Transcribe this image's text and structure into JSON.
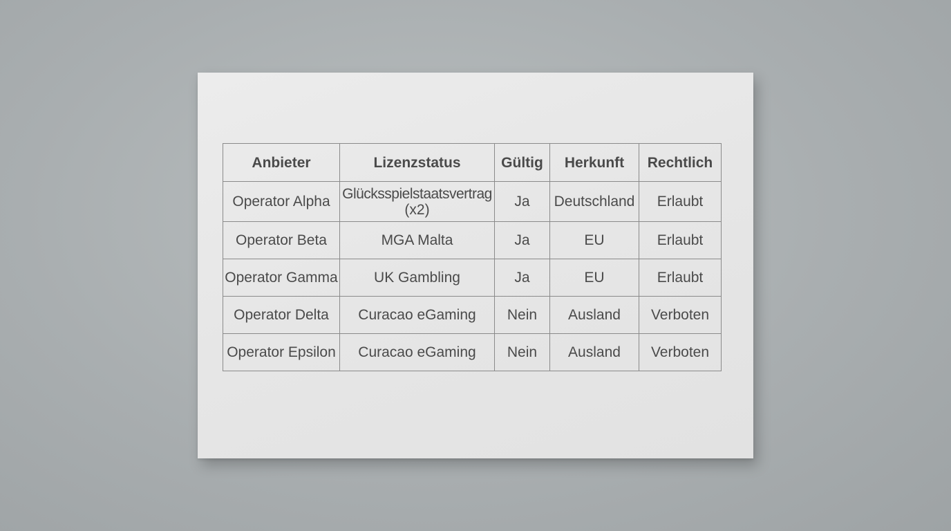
{
  "table": {
    "headers": [
      "Anbieter",
      "Lizenzstatus",
      "Gültig",
      "Herkunft",
      "Rechtlich"
    ],
    "rows": [
      {
        "anbieter": "Operator Alpha",
        "lizenzstatus_line1": "Glücksspielstaatsvertrag",
        "lizenzstatus_line2": "(x2)",
        "gueltig": "Ja",
        "herkunft": "Deutschland",
        "rechtlich": "Erlaubt"
      },
      {
        "anbieter": "Operator Beta",
        "lizenzstatus": "MGA Malta",
        "gueltig": "Ja",
        "herkunft": "EU",
        "rechtlich": "Erlaubt"
      },
      {
        "anbieter": "Operator Gamma",
        "lizenzstatus": "UK Gambling",
        "gueltig": "Ja",
        "herkunft": "EU",
        "rechtlich": "Erlaubt"
      },
      {
        "anbieter": "Operator Delta",
        "lizenzstatus": "Curacao eGaming",
        "gueltig": "Nein",
        "herkunft": "Ausland",
        "rechtlich": "Verboten"
      },
      {
        "anbieter": "Operator Epsilon",
        "lizenzstatus": "Curacao eGaming",
        "gueltig": "Nein",
        "herkunft": "Ausland",
        "rechtlich": "Verboten"
      }
    ]
  },
  "colors": {
    "background": "#a9aeb0",
    "paper": "#e6e6e6",
    "text": "#4a4a4a",
    "border": "#8a8a8a"
  }
}
